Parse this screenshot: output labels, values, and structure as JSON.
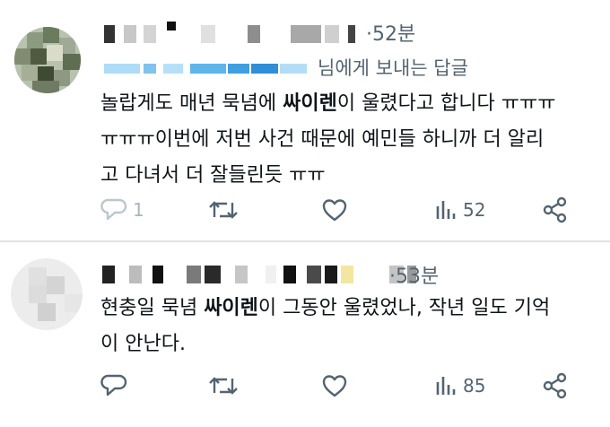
{
  "replies": [
    {
      "time": "·52분",
      "replying_to": "님에게 보내는 답글",
      "text_before": "놀랍게도 매년 묵념에 ",
      "text_bold": "싸이렌",
      "text_after": "이 울렸다고 합니다 ㅠㅠㅠ\nㅠㅠㅠ이번에 저번 사건 때문에 예민들 하니까 더 알리\n고 다녀서 더 잘들린듯 ㅠㅠ",
      "reply_count": "1",
      "views": "52"
    },
    {
      "time": "·53분",
      "text_before": "현충일 묵념 ",
      "text_bold": "싸이렌",
      "text_after": "이 그동안 울렸었나, 작년 일도 기억\n이 안난다.",
      "reply_count": "",
      "views": "85"
    }
  ],
  "icons": {
    "reply": "speech-bubble-icon",
    "repost": "repost-arrows-icon",
    "like": "heart-icon",
    "views": "bar-chart-icon",
    "share": "share-icon"
  },
  "colors": {
    "text": "#0f1419",
    "muted": "#536471",
    "reply_link": "#1d9bf0",
    "divider": "#dfe3e7"
  }
}
